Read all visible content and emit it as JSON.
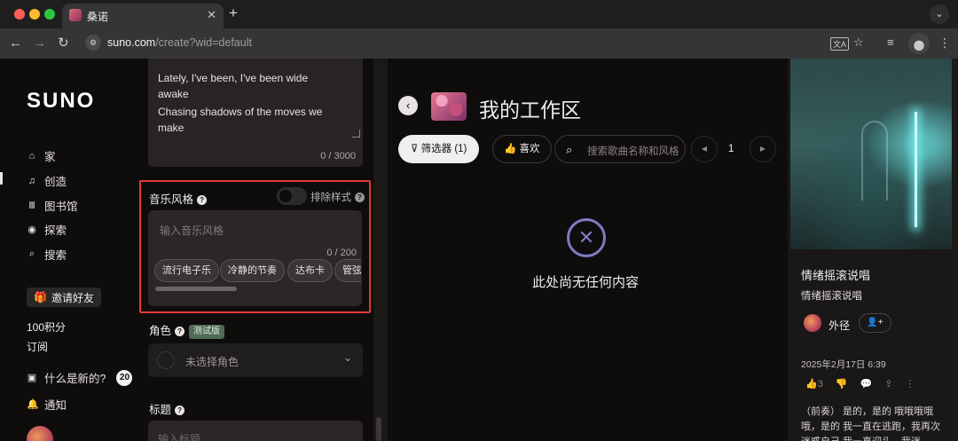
{
  "browser": {
    "tab_title": "桑诺",
    "url_host": "suno.com",
    "url_path": "/create?wid=default"
  },
  "sidebar": {
    "logo": "SUNO",
    "items": [
      {
        "label": "家",
        "icon": "home-icon"
      },
      {
        "label": "创造",
        "icon": "music-note-icon"
      },
      {
        "label": "图书馆",
        "icon": "library-icon"
      },
      {
        "label": "探索",
        "icon": "compass-icon"
      },
      {
        "label": "搜索",
        "icon": "search-icon"
      }
    ],
    "invite_label": "邀请好友",
    "credits": "100积分",
    "subscribe": "订阅",
    "whats_new": "什么是新的?",
    "whats_new_count": "20",
    "notifications": "通知"
  },
  "create": {
    "lyrics_lines": [
      "Lately, I've been, I've been wide awake",
      "Chasing shadows of the moves we make"
    ],
    "lyrics_count": "0 / 3000",
    "style_label": "音乐风格",
    "exclude_label": "排除样式",
    "style_placeholder": "输入音乐风格",
    "style_count": "0 / 200",
    "style_chips": [
      "流行电子乐",
      "冷静的节奏",
      "达布卡",
      "管弦"
    ],
    "role_label": "角色",
    "role_beta": "测试版",
    "role_placeholder": "未选择角色",
    "title_label": "标题",
    "title_placeholder": "输入标题"
  },
  "workspace": {
    "title": "我的工作区",
    "filter_label": "筛选器",
    "filter_count": "(1)",
    "like_label": "喜欢",
    "search_placeholder": "搜索歌曲名称和风格",
    "page": "1",
    "empty_text": "此处尚无任何内容"
  },
  "song_panel": {
    "title": "情绪摇滚说唱",
    "style": "情绪摇滚说唱",
    "artist": "外径",
    "date": "2025年2月17日 6:39",
    "likes": "3",
    "lyrics": "（前奏） 是的，是的 哦哦哦哦哦，是的 我一直在逃跑，我再次迷惑自己 我一直迎头，我迷"
  },
  "colors": {
    "highlight_border": "#e23b36",
    "background": "#0f0c0c",
    "empty_icon": "#7e7bc6"
  }
}
